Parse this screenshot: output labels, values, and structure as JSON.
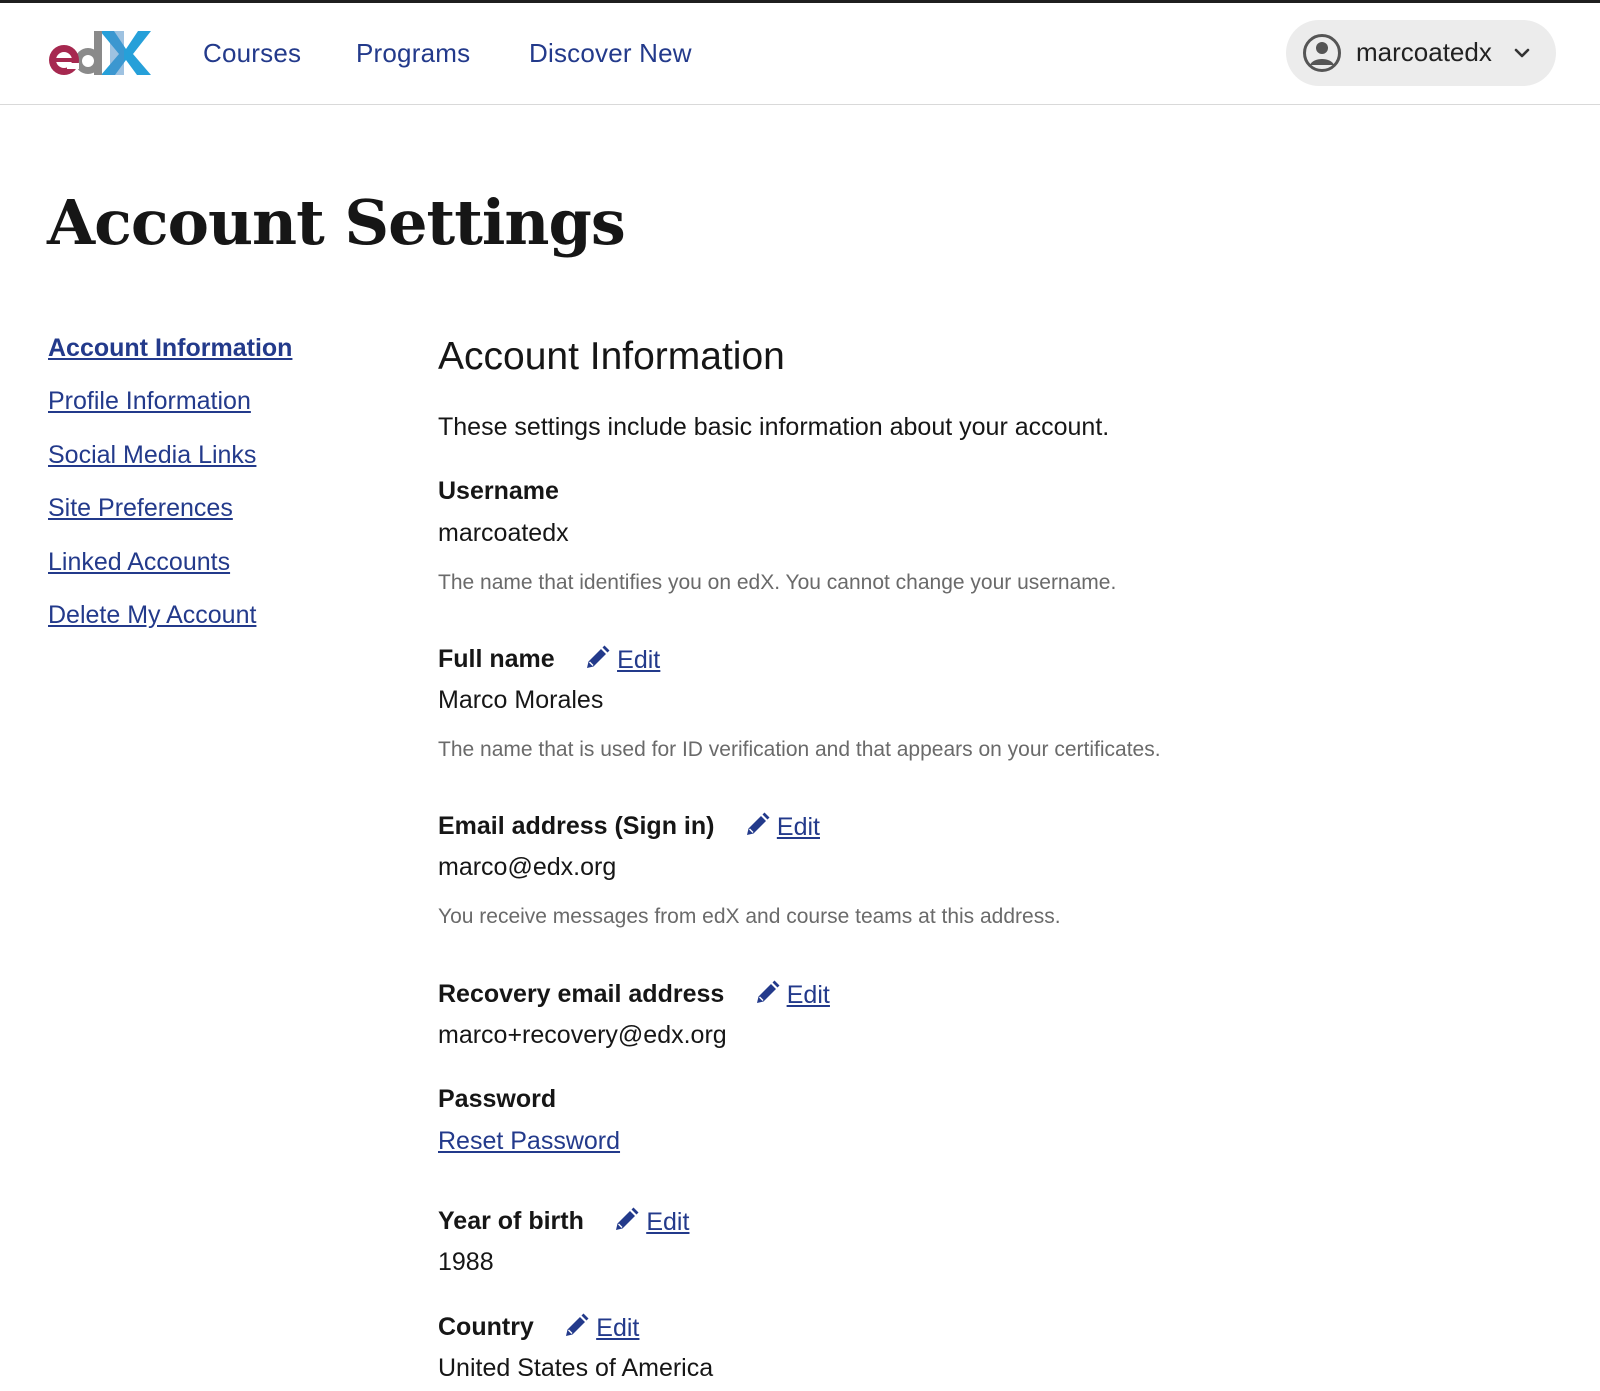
{
  "brand": {
    "logo_text": "edX"
  },
  "header": {
    "nav": [
      "Courses",
      "Programs",
      "Discover New"
    ],
    "user": {
      "username": "marcoatedx"
    }
  },
  "page": {
    "title": "Account Settings"
  },
  "sidebar": {
    "items": [
      {
        "label": "Account Information",
        "active": true
      },
      {
        "label": "Profile Information"
      },
      {
        "label": "Social Media Links"
      },
      {
        "label": "Site Preferences"
      },
      {
        "label": "Linked Accounts"
      },
      {
        "label": "Delete My Account"
      }
    ]
  },
  "section": {
    "title": "Account Information",
    "description": "These settings include basic information about your account.",
    "edit_label": "Edit",
    "fields": {
      "username": {
        "label": "Username",
        "value": "marcoatedx",
        "help": "The name that identifies you on edX. You cannot change your username."
      },
      "full_name": {
        "label": "Full name",
        "value": "Marco Morales",
        "help": "The name that is used for ID verification and that appears on your certificates."
      },
      "email": {
        "label": "Email address (Sign in)",
        "value": "marco@edx.org",
        "help": "You receive messages from edX and course teams at this address."
      },
      "recovery_email": {
        "label": "Recovery email address",
        "value": "marco+recovery@edx.org"
      },
      "password": {
        "label": "Password",
        "link": "Reset Password"
      },
      "year_of_birth": {
        "label": "Year of birth",
        "value": "1988"
      },
      "country": {
        "label": "Country",
        "value": "United States of America"
      }
    }
  },
  "colors": {
    "link": "#233a8b",
    "text": "#161616",
    "muted": "#6a6a6a",
    "logo_e": "#a6284f",
    "logo_d": "#8a8a8a",
    "logo_x": "#1a9bd7"
  }
}
